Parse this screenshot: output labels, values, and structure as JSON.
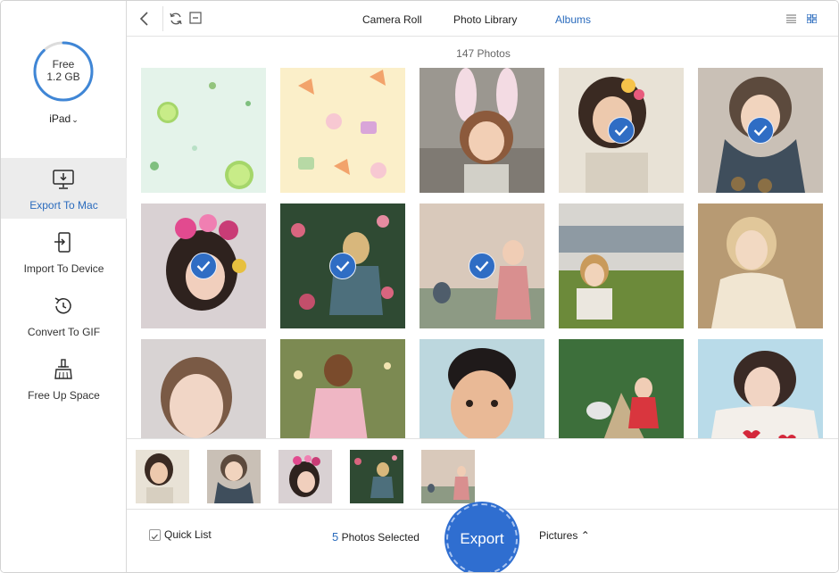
{
  "sidebar": {
    "storage": {
      "line1": "Free",
      "line2": "1.2 GB",
      "used_fraction": 0.12
    },
    "device": "iPad",
    "items": [
      {
        "label": "Export To Mac",
        "icon": "export-to-mac-icon",
        "active": true
      },
      {
        "label": "Import To Device",
        "icon": "import-to-device-icon",
        "active": false
      },
      {
        "label": "Convert To GIF",
        "icon": "convert-to-gif-icon",
        "active": false
      },
      {
        "label": "Free Up Space",
        "icon": "broom-icon",
        "active": false
      }
    ]
  },
  "toolbar": {
    "tabs": [
      {
        "label": "Camera Roll",
        "active": false
      },
      {
        "label": "Photo Library",
        "active": false
      },
      {
        "label": "Albums",
        "active": true
      }
    ]
  },
  "photos": {
    "count_label": "147 Photos",
    "items": [
      {
        "theme": "lime pattern",
        "selected": false
      },
      {
        "theme": "food pattern",
        "selected": false
      },
      {
        "theme": "bunny ears girl",
        "selected": false
      },
      {
        "theme": "girl flowers",
        "selected": true
      },
      {
        "theme": "girl scarf",
        "selected": true
      },
      {
        "theme": "girl flower crown",
        "selected": true
      },
      {
        "theme": "girl garden",
        "selected": true
      },
      {
        "theme": "girl park",
        "selected": true
      },
      {
        "theme": "girl grass",
        "selected": false
      },
      {
        "theme": "girl praying",
        "selected": false
      },
      {
        "theme": "girl portrait",
        "selected": false
      },
      {
        "theme": "girl dress field",
        "selected": false
      },
      {
        "theme": "boy portrait",
        "selected": false
      },
      {
        "theme": "girl with dog",
        "selected": false
      },
      {
        "theme": "girl hearts sweater",
        "selected": false
      }
    ]
  },
  "bottom": {
    "quick_list_label": "Quick List",
    "selected_count": "5",
    "selected_text": "Photos Selected",
    "export_label": "Export",
    "destination": "Pictures"
  },
  "colors": {
    "accent": "#2a6bbd",
    "export": "#2f6ed0",
    "selection": "#2a5ea8"
  }
}
